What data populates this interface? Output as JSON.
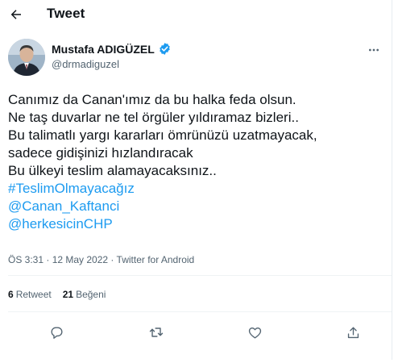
{
  "header": {
    "title": "Tweet"
  },
  "author": {
    "name": "Mustafa ADIGÜZEL",
    "handle": "@drmadiguzel",
    "verified": true
  },
  "tweet": {
    "lines": [
      "Canımız da Canan'ımız da bu halka feda olsun.",
      "Ne taş duvarlar ne tel örgüler yıldıramaz bizleri..",
      "Bu talimatlı yargı kararları ömrünüzü uzatmayacak,",
      "sadece gidişinizi hızlandıracak",
      "Bu ülkeyi teslim alamayacaksınız.."
    ],
    "hashtag": "#TeslimOlmayacağız",
    "mentions": [
      "@Canan_Kaftanci",
      "@herkesicinCHP"
    ],
    "meta": "ÖS 3:31 · 12 May 2022 · Twitter for Android"
  },
  "stats": {
    "retweets_count": "6",
    "retweets_label": "Retweet",
    "likes_count": "21",
    "likes_label": "Beğeni"
  },
  "colors": {
    "link": "#1d9bf0",
    "verified": "#1d9bf0",
    "secondary_text": "#536471",
    "icon": "#536471"
  },
  "icons": {
    "back": "arrow-left-icon",
    "verified": "verified-badge-icon",
    "more": "more-dots-icon",
    "reply": "reply-icon",
    "retweet": "retweet-icon",
    "like": "heart-icon",
    "share": "share-icon"
  }
}
